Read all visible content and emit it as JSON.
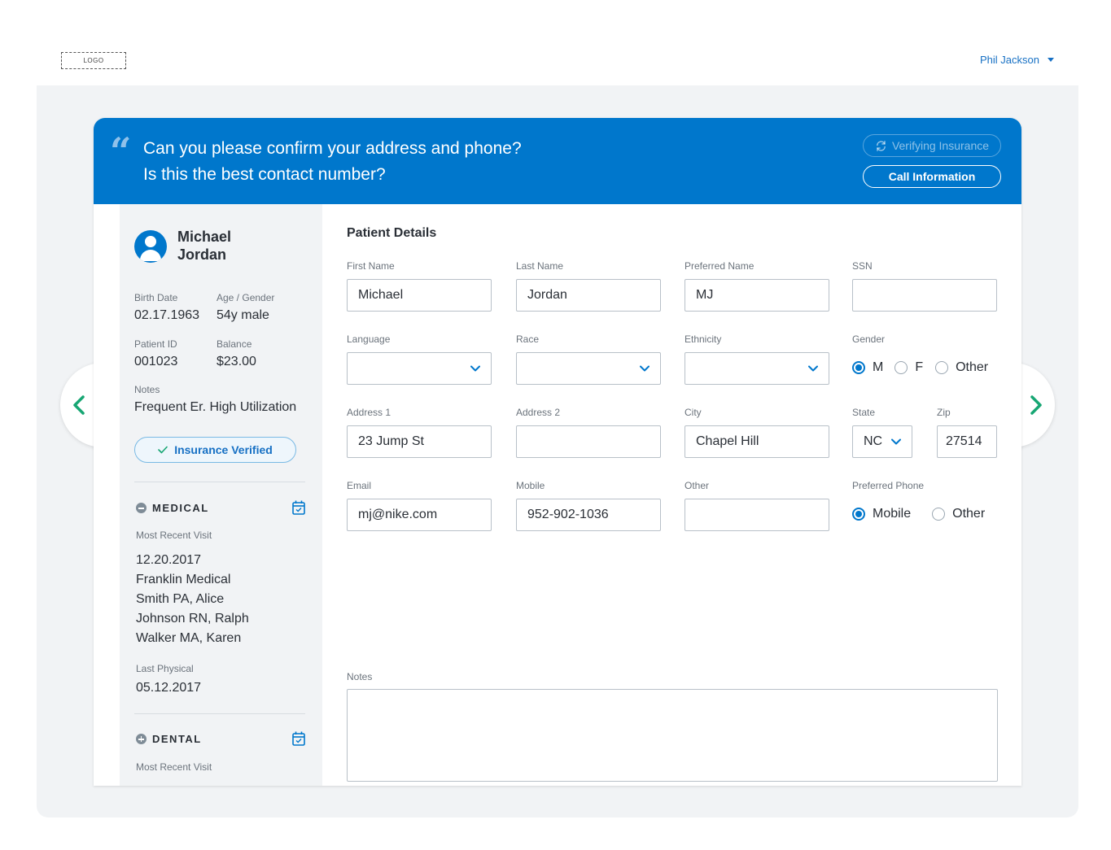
{
  "header": {
    "logo": "LOGO",
    "user_name": "Phil Jackson"
  },
  "prompt": {
    "line1": "Can you please confirm your address and phone?",
    "line2": "Is this the best contact number?",
    "verifying_label": "Verifying Insurance",
    "call_info_label": "Call Information"
  },
  "patient": {
    "first_name": "Michael",
    "last_name": "Jordan",
    "birth_date_label": "Birth Date",
    "birth_date": "02.17.1963",
    "age_gender_label": "Age / Gender",
    "age_gender": "54y male",
    "id_label": "Patient ID",
    "id": "001023",
    "balance_label": "Balance",
    "balance": "$23.00",
    "notes_label": "Notes",
    "notes": "Frequent Er. High Utilization",
    "insurance_status": "Insurance Verified"
  },
  "medical": {
    "title": "MEDICAL",
    "recent_label": "Most Recent Visit",
    "recent_lines": [
      "12.20.2017",
      "Franklin Medical",
      "Smith PA, Alice",
      "Johnson RN, Ralph",
      "Walker MA, Karen"
    ],
    "physical_label": "Last Physical",
    "physical_date": "05.12.2017"
  },
  "dental": {
    "title": "DENTAL",
    "recent_label": "Most Recent Visit"
  },
  "form": {
    "title": "Patient Details",
    "first_name": {
      "label": "First Name",
      "value": "Michael"
    },
    "last_name": {
      "label": "Last Name",
      "value": "Jordan"
    },
    "preferred_name": {
      "label": "Preferred Name",
      "value": "MJ"
    },
    "ssn": {
      "label": "SSN",
      "value": ""
    },
    "language": {
      "label": "Language",
      "value": ""
    },
    "race": {
      "label": "Race",
      "value": ""
    },
    "ethnicity": {
      "label": "Ethnicity",
      "value": ""
    },
    "gender": {
      "label": "Gender",
      "options": [
        "M",
        "F",
        "Other"
      ],
      "selected": "M"
    },
    "address1": {
      "label": "Address 1",
      "value": "23 Jump St"
    },
    "address2": {
      "label": "Address 2",
      "value": ""
    },
    "city": {
      "label": "City",
      "value": "Chapel Hill"
    },
    "state": {
      "label": "State",
      "value": "NC"
    },
    "zip": {
      "label": "Zip",
      "value": "27514"
    },
    "email": {
      "label": "Email",
      "value": "mj@nike.com"
    },
    "mobile": {
      "label": "Mobile",
      "value": "952-902-1036"
    },
    "other_phone": {
      "label": "Other",
      "value": ""
    },
    "preferred_phone": {
      "label": "Preferred Phone",
      "options": [
        "Mobile",
        "Other"
      ],
      "selected": "Mobile"
    },
    "notes": {
      "label": "Notes",
      "value": ""
    }
  },
  "colors": {
    "brand_blue": "#0077cc",
    "accent_green": "#17a673",
    "background": "#f1f3f5"
  },
  "icons": {
    "prev": "chevron-left-icon",
    "next": "chevron-right-icon",
    "quote": "quote-icon",
    "refresh": "refresh-icon",
    "avatar": "user-avatar-icon",
    "check": "check-icon",
    "calendar": "calendar-check-icon"
  }
}
